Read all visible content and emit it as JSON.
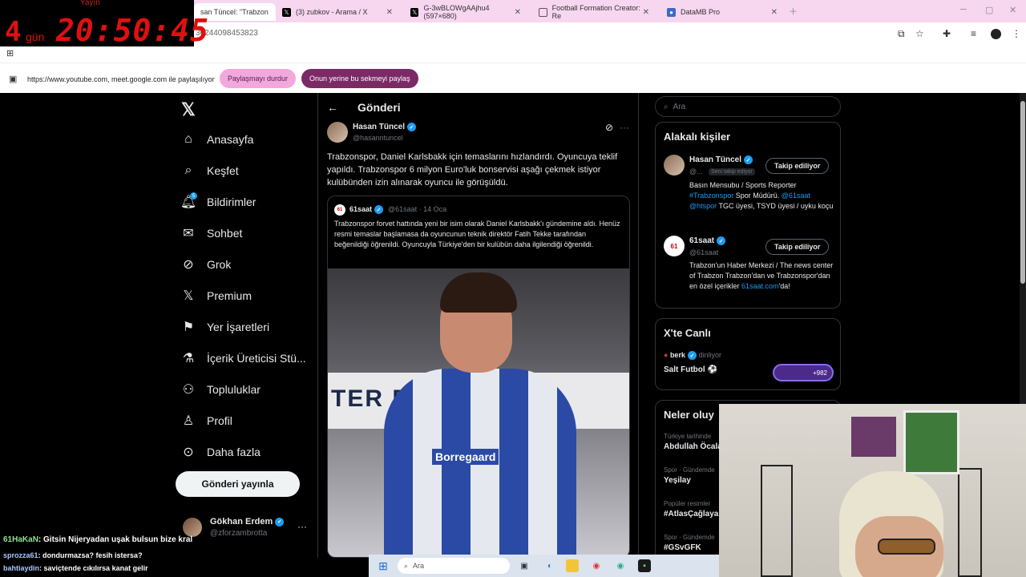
{
  "timer": {
    "top_label": "Yayın",
    "days": "4",
    "days_word": "gün",
    "clock": "20:50:45"
  },
  "tabs": [
    {
      "label": "san Tüncel: \"Trabzon",
      "active": true
    },
    {
      "label": "(3) zubkov - Arama / X"
    },
    {
      "label": "G-3wBLOWgAAjhu4 (597×680)"
    },
    {
      "label": "Football Formation Creator: Re"
    },
    {
      "label": "DataMB Pro"
    }
  ],
  "address": {
    "url": "36244098453823"
  },
  "share": {
    "text": "https://www.youtube.com, meet.google.com ile paylaşılıyor",
    "stop_label": "Paylaşmayı durdur",
    "share_tab_label": "Onun yerine bu sekmeyi paylaş"
  },
  "nav": {
    "items": [
      "Anasayfa",
      "Keşfet",
      "Bildirimler",
      "Sohbet",
      "Grok",
      "Premium",
      "Yer İşaretleri",
      "İçerik Üreticisi Stü...",
      "Topluluklar",
      "Profil",
      "Daha fazla"
    ],
    "notif_count": "5",
    "post_button": "Gönderi yayınla",
    "profile_name": "Gökhan Erdem",
    "profile_handle": "@zforzambrotta"
  },
  "post": {
    "header": "Gönderi",
    "author": "Hasan Tüncel",
    "handle": "@hasanntuncel",
    "text": "Trabzonspor, Daniel Karlsbakk için temaslarını hızlandırdı.  Oyuncuya teklif yapıldı. Trabzonspor 6 milyon Euro'luk bonservisi aşağı çekmek istiyor kulübünden izin alınarak oyuncu ile görüşüldü.",
    "quote": {
      "author": "61saat",
      "handle_date": "@61saat · 14 Oca",
      "text": "Trabzonspor forvet hattında yeni bir isim olarak Daniel Karlsbakk'ı gündemine aldı. Henüz resmi temaslar başlamasa da oyuncunun teknik direktör Fatih Tekke tarafından beğenildiği öğrenildi. Oyuncuyla Türkiye'den bir kulübün daha ilgilendiği öğrenildi.",
      "banner_text": "TER RE",
      "shirt_text": "Borregaard"
    }
  },
  "search": {
    "placeholder": "Ara"
  },
  "related": {
    "title": "Alakalı kişiler",
    "people": [
      {
        "name": "Hasan Tüncel",
        "handle": "@...",
        "chip": "Seni takip ediyor",
        "button": "Takip ediliyor",
        "bio_parts": [
          "Basın Mensubu / Sports Reporter ",
          "#Trabzonspor",
          " Spor Müdürü. ",
          "@61saat",
          " ",
          "@htspor",
          " TGC üyesi, TSYD üyesi / uyku koçu"
        ]
      },
      {
        "name": "61saat",
        "handle": "@61saat",
        "button": "Takip ediliyor",
        "bio_parts": [
          "Trabzon'un Haber Merkezi / The news center of Trabzon Trabzon'dan ve Trabzonspor'dan en özel içerikler ",
          "61saat.com",
          "'da!"
        ]
      }
    ]
  },
  "live": {
    "title": "X'te Canlı",
    "host": "berk",
    "status": "dinliyor",
    "name": "Salt Futbol ⚽",
    "count": "+982"
  },
  "trends": {
    "title": "Neler oluy",
    "items": [
      {
        "category": "Türkiye tarihinde",
        "name": "Abdullah Öcala"
      },
      {
        "category": "Spor · Gündemde",
        "name": "Yeşilay"
      },
      {
        "category": "Popüler resimler",
        "name": "#AtlasÇağlaya"
      },
      {
        "category": "Spor · Gündemde",
        "name": "#GSvGFK"
      }
    ]
  },
  "chat": [
    {
      "user": "61HaKaN",
      "msg": ": Gitsin Nijeryadan uşak bulsun bize kral"
    },
    {
      "user": "sprozza61",
      "msg": ": dondurmazsa? fesih istersa?"
    },
    {
      "user": "bahtiaydin",
      "msg": ": saviçtende cıkılırsa kanat gelir"
    }
  ],
  "taskbar": {
    "search": "Ara"
  }
}
